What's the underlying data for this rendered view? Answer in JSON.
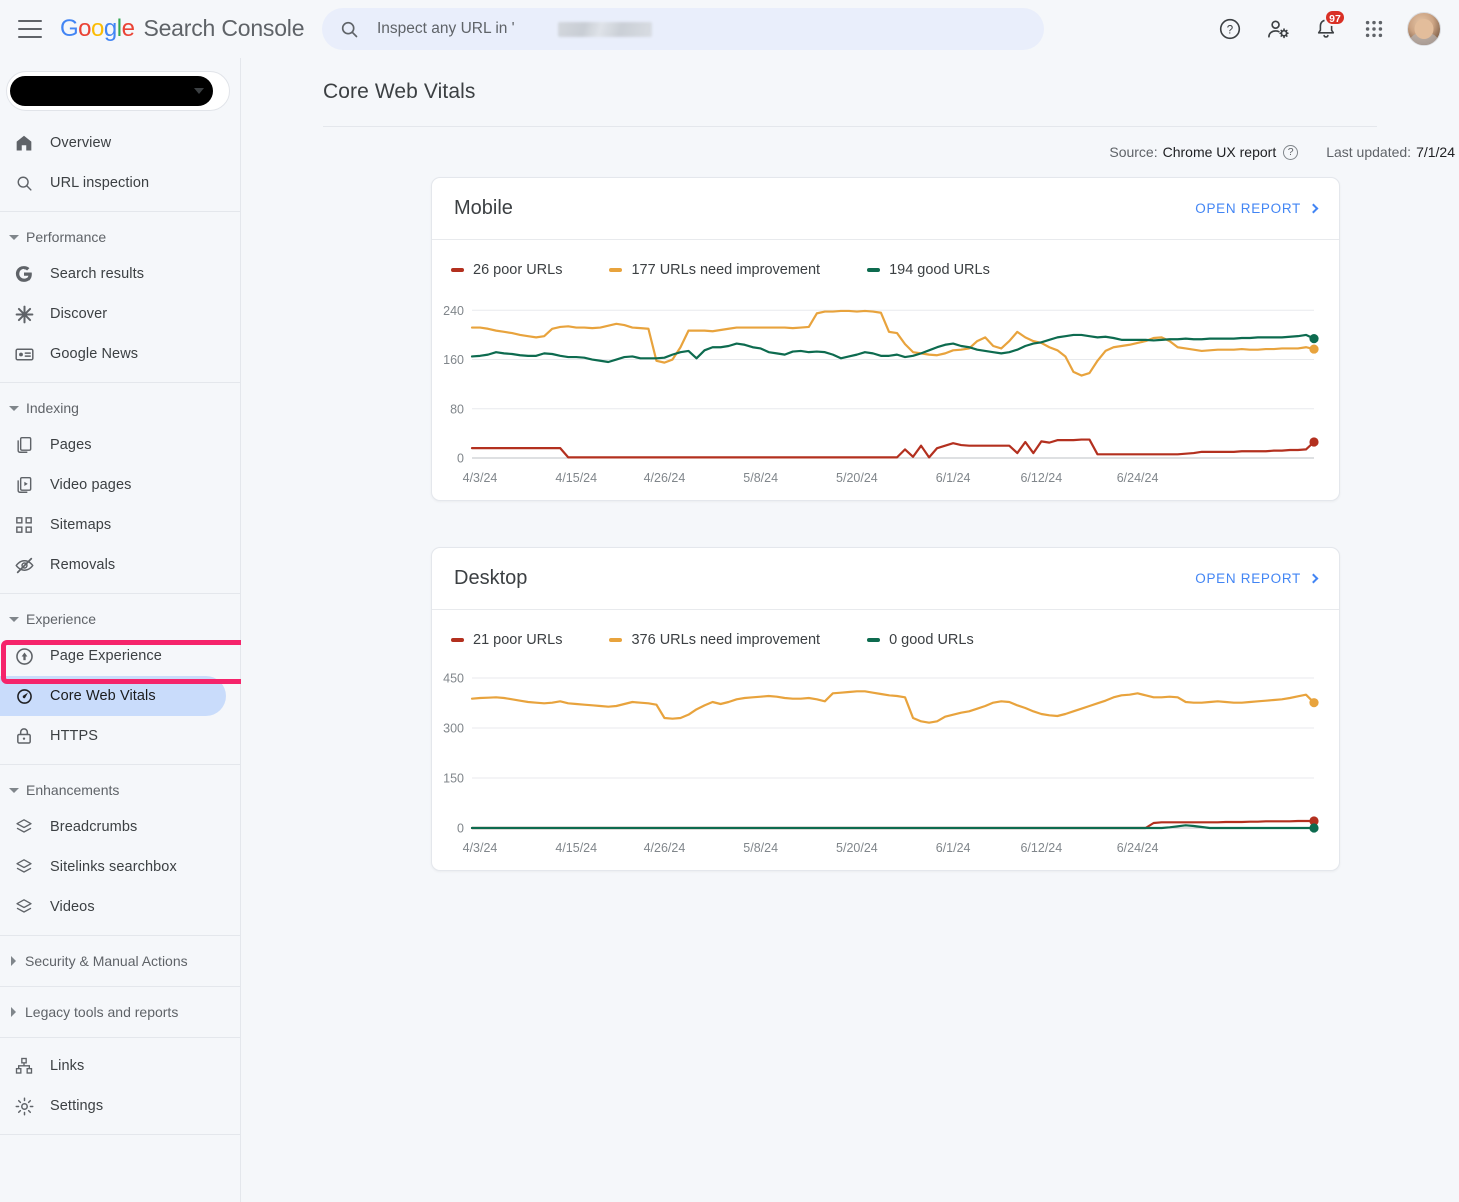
{
  "app": {
    "brand_google": "Google",
    "brand_suffix": "Search Console",
    "hamburger_icon": "menu-icon"
  },
  "search": {
    "placeholder": "Inspect any URL in '",
    "value": "",
    "icon": "search-icon"
  },
  "topbar_icons": {
    "help": "help-icon",
    "user_settings": "user-settings-icon",
    "notifications": "bell-icon",
    "notification_count": "97",
    "apps": "apps-grid-icon",
    "avatar": "user-avatar"
  },
  "sidebar": {
    "property_selector": {
      "label": "",
      "redacted": true,
      "chevron": "chevron-down-icon"
    },
    "items": [
      {
        "label": "Overview",
        "icon": "home-icon",
        "type": "item"
      },
      {
        "label": "URL inspection",
        "icon": "search-icon",
        "type": "item"
      },
      {
        "type": "separator"
      },
      {
        "label": "Performance",
        "icon": "caret-down-icon",
        "type": "group",
        "expanded": true
      },
      {
        "label": "Search results",
        "icon": "google-g-icon",
        "type": "item"
      },
      {
        "label": "Discover",
        "icon": "discover-asterisk-icon",
        "type": "item"
      },
      {
        "label": "Google News",
        "icon": "news-card-icon",
        "type": "item"
      },
      {
        "type": "separator"
      },
      {
        "label": "Indexing",
        "icon": "caret-down-icon",
        "type": "group",
        "expanded": true
      },
      {
        "label": "Pages",
        "icon": "pages-icon",
        "type": "item"
      },
      {
        "label": "Video pages",
        "icon": "video-pages-icon",
        "type": "item"
      },
      {
        "label": "Sitemaps",
        "icon": "sitemaps-icon",
        "type": "item"
      },
      {
        "label": "Removals",
        "icon": "eye-off-icon",
        "type": "item"
      },
      {
        "type": "separator"
      },
      {
        "label": "Experience",
        "icon": "caret-down-icon",
        "type": "group",
        "expanded": true
      },
      {
        "label": "Page Experience",
        "icon": "page-experience-icon",
        "type": "item"
      },
      {
        "label": "Core Web Vitals",
        "icon": "speedometer-icon",
        "type": "item",
        "active": true
      },
      {
        "label": "HTTPS",
        "icon": "lock-icon",
        "type": "item"
      },
      {
        "type": "separator"
      },
      {
        "label": "Enhancements",
        "icon": "caret-down-icon",
        "type": "group",
        "expanded": true
      },
      {
        "label": "Breadcrumbs",
        "icon": "layers-icon",
        "type": "item"
      },
      {
        "label": "Sitelinks searchbox",
        "icon": "layers-icon",
        "type": "item"
      },
      {
        "label": "Videos",
        "icon": "layers-icon",
        "type": "item"
      },
      {
        "type": "separator"
      },
      {
        "label": "Security & Manual Actions",
        "icon": "caret-right-icon",
        "type": "group",
        "expanded": false
      },
      {
        "type": "separator"
      },
      {
        "label": "Legacy tools and reports",
        "icon": "caret-right-icon",
        "type": "group",
        "expanded": false
      },
      {
        "type": "separator"
      },
      {
        "label": "Links",
        "icon": "links-sitemap-icon",
        "type": "item"
      },
      {
        "label": "Settings",
        "icon": "gear-icon",
        "type": "item"
      }
    ]
  },
  "page": {
    "title": "Core Web Vitals",
    "source_label": "Source:",
    "source_value": "Chrome UX report",
    "source_help_icon": "help-circle-icon",
    "last_updated_label": "Last updated:",
    "last_updated_value": "7/1/24"
  },
  "annotations": {
    "highlight_box_color": "#f5246b",
    "arrow_color": "#f5246b",
    "arrow_direction": "left",
    "targets": "Core Web Vitals"
  },
  "colors": {
    "poor": "#b3301f",
    "needs_improvement": "#e8a33d",
    "good": "#0d6b4f",
    "link": "#4285f4",
    "active_nav": "#c9dcfb"
  },
  "cards": [
    {
      "title": "Mobile",
      "open_report": "OPEN REPORT",
      "legend": [
        {
          "label": "26 poor URLs",
          "color": "#b3301f"
        },
        {
          "label": "177 URLs need improvement",
          "color": "#e8a33d"
        },
        {
          "label": "194 good URLs",
          "color": "#0d6b4f"
        }
      ]
    },
    {
      "title": "Desktop",
      "open_report": "OPEN REPORT",
      "legend": [
        {
          "label": "21 poor URLs",
          "color": "#b3301f"
        },
        {
          "label": "376 URLs need improvement",
          "color": "#e8a33d"
        },
        {
          "label": "0 good URLs",
          "color": "#0d6b4f"
        }
      ]
    }
  ],
  "chart_data": [
    {
      "type": "line",
      "title": "Mobile",
      "xlabel": "",
      "ylabel": "",
      "ylim": [
        0,
        260
      ],
      "yticks": [
        0,
        80,
        160,
        240
      ],
      "grid": true,
      "legend_position": "top-left",
      "xticks": [
        "4/3/24",
        "4/15/24",
        "4/26/24",
        "5/8/24",
        "5/20/24",
        "6/1/24",
        "6/12/24",
        "6/24/24"
      ],
      "xtick_indices": [
        1,
        13,
        24,
        36,
        48,
        60,
        71,
        83
      ],
      "series": [
        {
          "name": "26 poor URLs",
          "color": "#b3301f",
          "values": [
            16,
            16,
            16,
            16,
            16,
            16,
            16,
            16,
            16,
            16,
            16,
            16,
            1,
            1,
            1,
            1,
            1,
            1,
            1,
            1,
            1,
            1,
            1,
            1,
            1,
            1,
            1,
            1,
            1,
            1,
            1,
            1,
            1,
            1,
            1,
            1,
            1,
            1,
            1,
            1,
            1,
            1,
            1,
            1,
            1,
            1,
            1,
            1,
            1,
            1,
            1,
            1,
            1,
            1,
            14,
            2,
            20,
            1,
            16,
            20,
            24,
            21,
            20,
            20,
            20,
            20,
            20,
            20,
            8,
            26,
            8,
            27,
            25,
            29,
            29,
            29,
            30,
            30,
            6,
            6,
            6,
            6,
            6,
            6,
            6,
            6,
            6,
            6,
            6,
            7,
            8,
            10,
            10,
            10,
            10,
            10,
            11,
            11,
            11,
            11,
            12,
            12,
            13,
            13,
            14,
            26
          ]
        },
        {
          "name": "177 URLs need improvement",
          "color": "#e8a33d",
          "values": [
            212,
            212,
            210,
            207,
            205,
            203,
            200,
            198,
            196,
            198,
            210,
            213,
            214,
            212,
            212,
            211,
            212,
            215,
            218,
            216,
            212,
            211,
            210,
            158,
            155,
            160,
            180,
            207,
            207,
            207,
            206,
            208,
            210,
            212,
            212,
            212,
            212,
            212,
            212,
            212,
            211,
            212,
            213,
            235,
            238,
            238,
            239,
            239,
            238,
            239,
            238,
            236,
            205,
            203,
            185,
            172,
            170,
            168,
            167,
            170,
            175,
            176,
            178,
            190,
            196,
            182,
            178,
            190,
            205,
            196,
            190,
            187,
            180,
            175,
            165,
            140,
            134,
            138,
            158,
            174,
            180,
            182,
            184,
            187,
            190,
            195,
            196,
            190,
            180,
            178,
            176,
            174,
            175,
            176,
            176,
            176,
            177,
            176,
            176,
            177,
            177,
            178,
            178,
            178,
            180,
            177
          ]
        },
        {
          "name": "194 good URLs",
          "color": "#0d6b4f",
          "values": [
            165,
            166,
            168,
            172,
            170,
            169,
            167,
            166,
            166,
            170,
            169,
            166,
            164,
            164,
            163,
            160,
            158,
            156,
            160,
            164,
            165,
            162,
            162,
            162,
            163,
            168,
            172,
            174,
            162,
            175,
            180,
            180,
            182,
            186,
            184,
            180,
            178,
            172,
            170,
            168,
            173,
            174,
            172,
            173,
            172,
            168,
            162,
            165,
            168,
            172,
            170,
            166,
            166,
            168,
            164,
            166,
            170,
            175,
            180,
            184,
            186,
            182,
            180,
            176,
            174,
            172,
            170,
            172,
            176,
            182,
            186,
            188,
            192,
            196,
            198,
            200,
            200,
            198,
            196,
            197,
            195,
            192,
            192,
            192,
            192,
            191,
            192,
            193,
            193,
            194,
            193,
            193,
            194,
            194,
            194,
            194,
            195,
            195,
            196,
            196,
            196,
            196,
            197,
            198,
            200,
            194
          ]
        }
      ]
    },
    {
      "type": "line",
      "title": "Desktop",
      "xlabel": "",
      "ylabel": "",
      "ylim": [
        0,
        480
      ],
      "yticks": [
        0,
        150,
        300,
        450
      ],
      "grid": true,
      "legend_position": "top-left",
      "xticks": [
        "4/3/24",
        "4/15/24",
        "4/26/24",
        "5/8/24",
        "5/20/24",
        "6/1/24",
        "6/12/24",
        "6/24/24"
      ],
      "xtick_indices": [
        1,
        13,
        24,
        36,
        48,
        60,
        71,
        83
      ],
      "series": [
        {
          "name": "21 poor URLs",
          "color": "#b3301f",
          "values": [
            0,
            0,
            0,
            0,
            0,
            0,
            0,
            0,
            0,
            0,
            0,
            0,
            0,
            0,
            0,
            0,
            0,
            0,
            0,
            0,
            0,
            0,
            0,
            0,
            0,
            0,
            0,
            0,
            0,
            0,
            0,
            0,
            0,
            0,
            0,
            0,
            0,
            0,
            0,
            0,
            0,
            0,
            0,
            0,
            0,
            0,
            0,
            0,
            0,
            0,
            0,
            0,
            0,
            0,
            0,
            0,
            0,
            0,
            0,
            0,
            0,
            0,
            0,
            0,
            0,
            0,
            0,
            0,
            0,
            0,
            0,
            0,
            0,
            0,
            0,
            0,
            0,
            0,
            0,
            0,
            0,
            0,
            0,
            0,
            0,
            15,
            17,
            17,
            17,
            17,
            17,
            17,
            17,
            17,
            18,
            18,
            18,
            19,
            19,
            20,
            20,
            20,
            20,
            21,
            21,
            21
          ]
        },
        {
          "name": "376 URLs need improvement",
          "color": "#e8a33d",
          "values": [
            388,
            390,
            391,
            392,
            390,
            386,
            382,
            378,
            376,
            374,
            376,
            380,
            374,
            372,
            370,
            368,
            366,
            364,
            366,
            372,
            378,
            376,
            374,
            370,
            330,
            328,
            330,
            340,
            356,
            368,
            378,
            372,
            378,
            386,
            390,
            392,
            394,
            396,
            394,
            390,
            388,
            388,
            390,
            386,
            380,
            404,
            406,
            408,
            410,
            410,
            406,
            402,
            398,
            396,
            392,
            330,
            320,
            316,
            320,
            334,
            340,
            346,
            350,
            358,
            366,
            376,
            380,
            378,
            368,
            360,
            350,
            342,
            338,
            336,
            342,
            350,
            358,
            366,
            374,
            382,
            392,
            398,
            400,
            404,
            398,
            392,
            392,
            394,
            392,
            378,
            376,
            376,
            378,
            380,
            378,
            376,
            376,
            378,
            380,
            382,
            384,
            386,
            390,
            395,
            400,
            376
          ]
        },
        {
          "name": "0 good URLs",
          "color": "#0d6b4f",
          "values": [
            0,
            0,
            0,
            0,
            0,
            0,
            0,
            0,
            0,
            0,
            0,
            0,
            0,
            0,
            0,
            0,
            0,
            0,
            0,
            0,
            0,
            0,
            0,
            0,
            0,
            0,
            0,
            0,
            0,
            0,
            0,
            0,
            0,
            0,
            0,
            0,
            0,
            0,
            0,
            0,
            0,
            0,
            0,
            0,
            0,
            0,
            0,
            0,
            0,
            0,
            0,
            0,
            0,
            0,
            0,
            0,
            0,
            0,
            0,
            0,
            0,
            0,
            0,
            0,
            0,
            0,
            0,
            0,
            0,
            0,
            0,
            0,
            0,
            0,
            0,
            0,
            0,
            0,
            0,
            0,
            0,
            0,
            0,
            0,
            0,
            0,
            0,
            2,
            5,
            8,
            6,
            3,
            0,
            0,
            0,
            0,
            0,
            0,
            0,
            0,
            0,
            0,
            0,
            0,
            0,
            0
          ]
        }
      ]
    }
  ]
}
